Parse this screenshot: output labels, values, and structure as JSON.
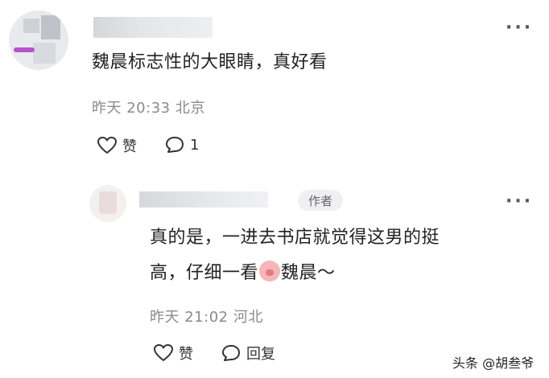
{
  "comment": {
    "text": "魏晨标志性的大眼睛，真好看",
    "meta": "昨天 20:33 北京",
    "like_label": "赞",
    "reply_count": "1",
    "more": "···"
  },
  "reply": {
    "author_badge": "作者",
    "text_line1": "真的是，一进去书店就觉得这男的挺",
    "text_line2_a": "高，仔细一看",
    "text_line2_b": "魏晨～",
    "meta": "昨天 21:02 河北",
    "like_label": "赞",
    "reply_label": "回复",
    "more": "···"
  },
  "watermark": "头条 @胡叁爷"
}
